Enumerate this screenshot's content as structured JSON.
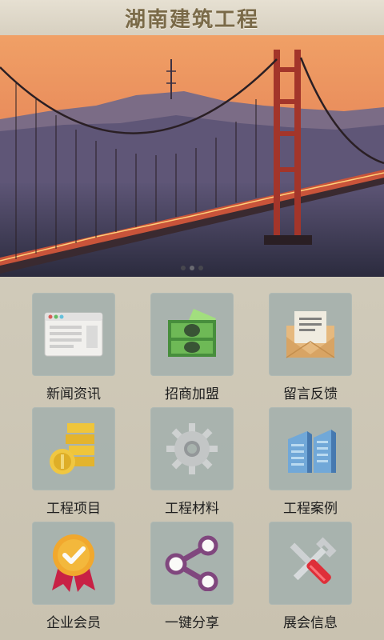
{
  "header": {
    "title": "湖南建筑工程"
  },
  "banner": {
    "slides": 3,
    "active_slide": 1
  },
  "menu": [
    {
      "label": "新闻资讯",
      "icon": "browser-window-icon"
    },
    {
      "label": "招商加盟",
      "icon": "money-bill-icon"
    },
    {
      "label": "留言反馈",
      "icon": "envelope-icon"
    },
    {
      "label": "工程项目",
      "icon": "coin-stack-icon"
    },
    {
      "label": "工程材料",
      "icon": "gear-icon"
    },
    {
      "label": "工程案例",
      "icon": "buildings-icon"
    },
    {
      "label": "企业会员",
      "icon": "award-badge-icon"
    },
    {
      "label": "一键分享",
      "icon": "share-icon"
    },
    {
      "label": "展会信息",
      "icon": "tools-icon"
    }
  ]
}
